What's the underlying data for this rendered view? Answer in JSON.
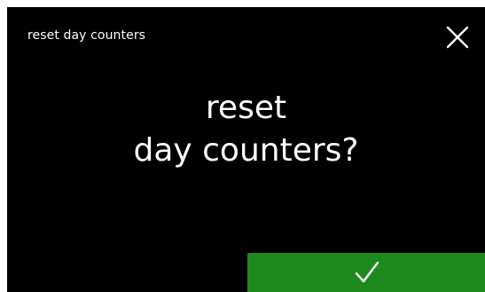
{
  "screen": {
    "title": "reset day counters",
    "question_line1": "reset",
    "question_line2": "day counters?",
    "close_icon": "close-icon",
    "confirm_icon": "checkmark-icon",
    "colors": {
      "background": "#000000",
      "text": "#ffffff",
      "confirm": "#1e8a1e"
    }
  }
}
